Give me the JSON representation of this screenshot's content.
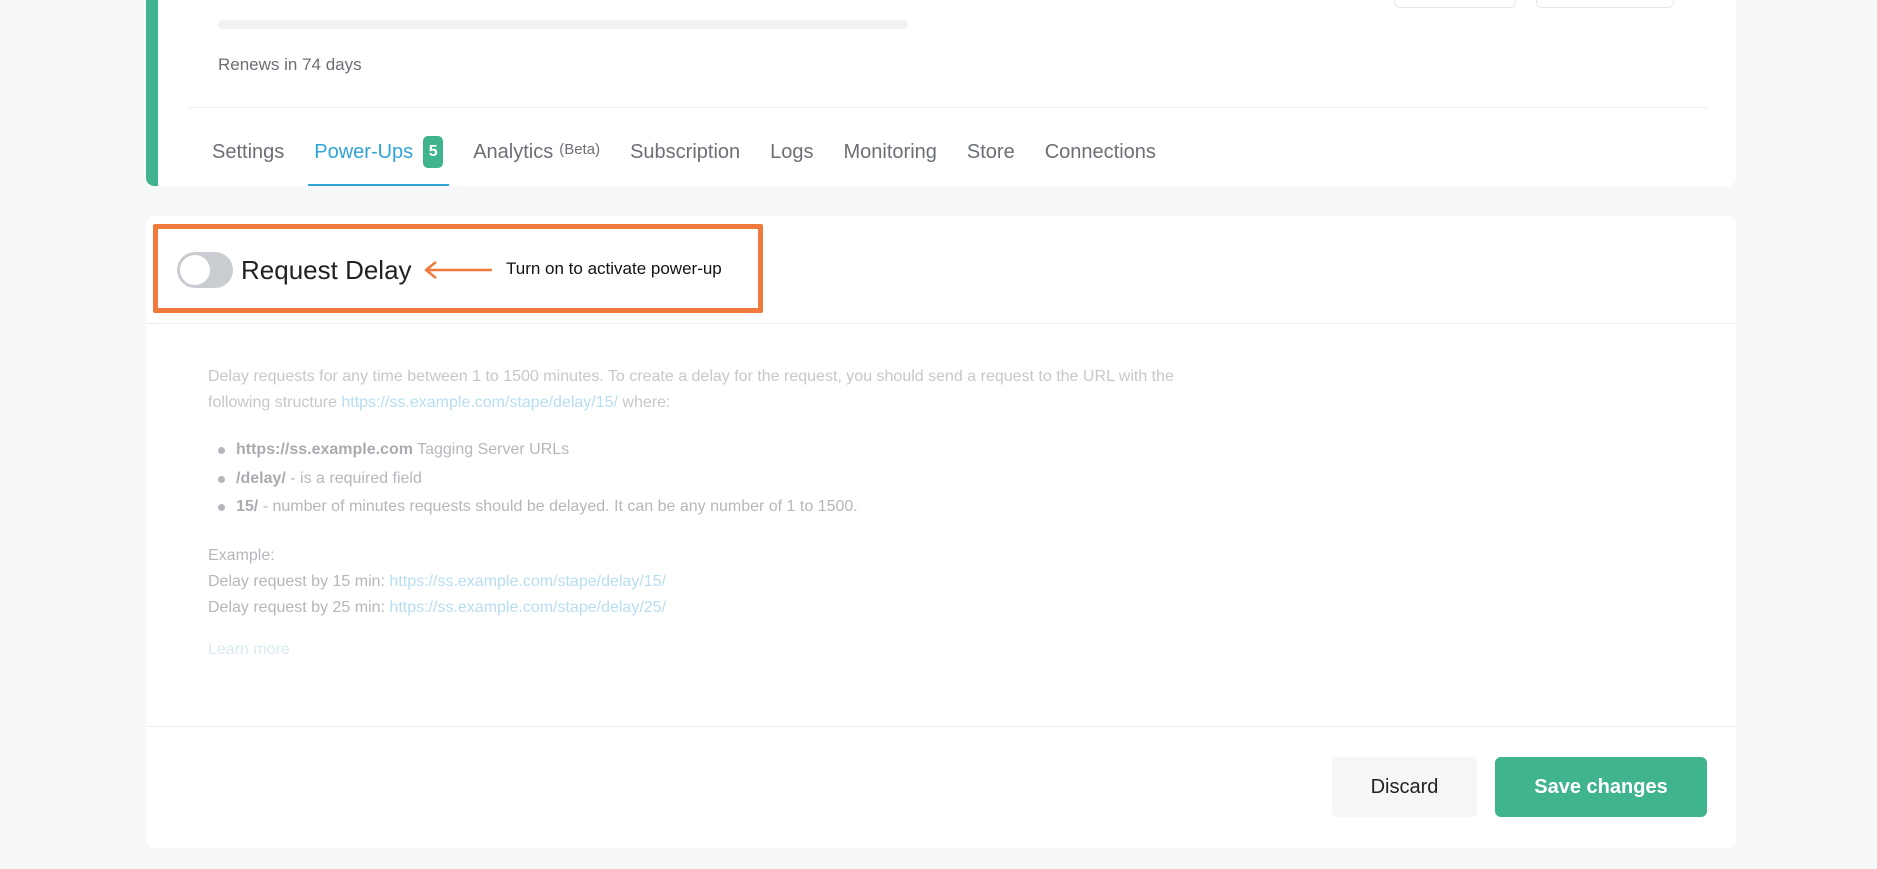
{
  "plan": {
    "renews_text": "Renews in 74 days"
  },
  "tabs": [
    {
      "label": "Settings"
    },
    {
      "label": "Power-Ups",
      "badge": "5"
    },
    {
      "label": "Analytics",
      "suffix": "(Beta)"
    },
    {
      "label": "Subscription"
    },
    {
      "label": "Logs"
    },
    {
      "label": "Monitoring"
    },
    {
      "label": "Store"
    },
    {
      "label": "Connections"
    }
  ],
  "powerup": {
    "title": "Request Delay",
    "enabled": false,
    "annotation": "Turn on to activate power-up",
    "desc_line1": "Delay requests for any time between 1 to 1500 minutes. To create a delay for the request, you should send a request to the URL with the",
    "desc_line2_prefix": "following structure ",
    "desc_link": "https://ss.example.com/stape/delay/15/",
    "desc_line2_suffix": " where:",
    "bullets": [
      {
        "strong": "https://ss.example.com",
        "text": " Tagging Server URLs"
      },
      {
        "strong": "/delay/",
        "text": " - is a required field"
      },
      {
        "strong": "15/",
        "text": " - number of minutes requests should be delayed. It can be any number of 1 to 1500."
      }
    ],
    "example_label": "Example:",
    "examples": [
      {
        "label": "Delay request by 15 min: ",
        "url": "https://ss.example.com/stape/delay/15/"
      },
      {
        "label": "Delay request by 25 min: ",
        "url": "https://ss.example.com/stape/delay/25/"
      }
    ],
    "learn_more": "Learn more"
  },
  "actions": {
    "discard": "Discard",
    "save": "Save changes"
  },
  "colors": {
    "accent_green": "#3fb48f",
    "active_tab_blue": "#2fa4d6",
    "highlight_orange": "#f07a3c"
  },
  "icons": {
    "annotation_arrow": "arrow-left-icon"
  }
}
